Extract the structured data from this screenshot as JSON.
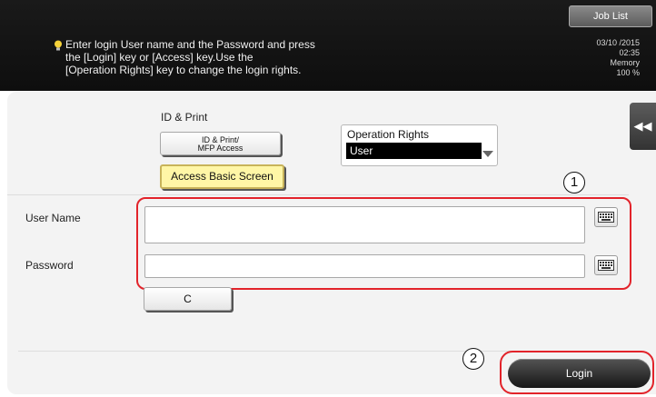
{
  "header": {
    "job_list_label": "Job List",
    "message": "Enter login User name and the Password and press\nthe [Login] key or [Access] key.Use the\n[Operation Rights] key to change the login rights.",
    "message_icon": "bulb-icon",
    "date": "03/10 /2015",
    "time": "02:35",
    "memory_label": "Memory",
    "memory_value": "100 %"
  },
  "side_toggle_label": "◀◀",
  "id_print": {
    "label": "ID & Print",
    "id_mfp_button": "ID & Print/\nMFP Access",
    "access_basic_button": "Access Basic Screen"
  },
  "operation_rights": {
    "label": "Operation Rights",
    "selected": "User"
  },
  "callouts": {
    "one": "1",
    "two": "2"
  },
  "form": {
    "user_name_label": "User Name",
    "user_name_value": "",
    "password_label": "Password",
    "password_value": "",
    "clear_button": "C"
  },
  "login_button": "Login",
  "colors": {
    "highlight": "#e2232a",
    "access_basic_bg": "#fff6a6"
  }
}
